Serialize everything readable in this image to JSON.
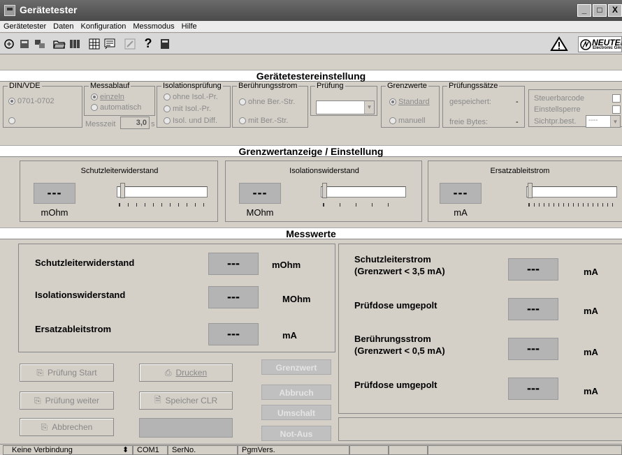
{
  "window": {
    "title": "Gerätetester",
    "minimize": "_",
    "maximize": "□",
    "close": "X"
  },
  "menu": [
    "Gerätetester",
    "Daten",
    "Konfiguration",
    "Messmodus",
    "Hilfe"
  ],
  "brand": {
    "logo_text": "NEUTEK",
    "logo_sub": "Electronic Gm"
  },
  "sections": {
    "einstellung": "Gerätetestereinstellung",
    "grenzwert": "Grenzwertanzeige / Einstellung",
    "messwerte": "Messwerte"
  },
  "settings": {
    "din": {
      "legend": "DIN/VDE",
      "opt1": "0701-0702",
      "opt2": ""
    },
    "messablauf": {
      "legend": "Messablauf",
      "opt1": "einzeln",
      "opt2": "automatisch",
      "messzeit_label": "Messzeit",
      "messzeit_value": "3,0",
      "messzeit_unit": "s"
    },
    "isolation": {
      "legend": "Isolationsprüfung",
      "opt1": "ohne Isol.-Pr.",
      "opt2": "mit Isol.-Pr.",
      "opt3": "Isol. und Diff."
    },
    "beruehrung": {
      "legend": "Berührungsstrom",
      "opt1": "ohne Ber.-Str.",
      "opt2": "mit Ber.-Str."
    },
    "pruefung": {
      "legend": "Prüfung",
      "value": ""
    },
    "grenzwerte": {
      "legend": "Grenzwerte",
      "opt1": "Standard",
      "opt2": "manuell"
    },
    "pruefsaetze": {
      "legend": "Prüfungssätze",
      "row1_label": "gespeichert:",
      "row1_value": "-",
      "row2_label": "freie Bytes:",
      "row2_value": "-"
    },
    "extra": {
      "barcode": "Steuerbarcode",
      "sperre": "Einstellsperre",
      "sichtpr": "Sichtpr.best.",
      "sichtpr_value": "----"
    }
  },
  "limits": [
    {
      "title": "Schutzleiterwiderstand",
      "display": "---",
      "unit": "mOhm"
    },
    {
      "title": "Isolationswiderstand",
      "display": "---",
      "unit": "MOhm"
    },
    {
      "title": "Ersatzableitstrom",
      "display": "---",
      "unit": "mA"
    }
  ],
  "measure_left": [
    {
      "label": "Schutzleiterwiderstand",
      "display": "---",
      "unit": "mOhm"
    },
    {
      "label": "Isolationswiderstand",
      "display": "---",
      "unit": "MOhm"
    },
    {
      "label": "Ersatzableitstrom",
      "display": "---",
      "unit": "mA"
    }
  ],
  "measure_right": [
    {
      "label1": "Schutzleiterstrom",
      "label2": "(Grenzwert < 3,5 mA)",
      "display": "---",
      "unit": "mA"
    },
    {
      "label1": "Prüfdose umgepolt",
      "label2": "",
      "display": "---",
      "unit": "mA"
    },
    {
      "label1": "Berührungsstrom",
      "label2": "(Grenzwert < 0,5 mA)",
      "display": "---",
      "unit": "mA"
    },
    {
      "label1": "Prüfdose umgepolt",
      "label2": "",
      "display": "---",
      "unit": "mA"
    }
  ],
  "buttons": {
    "start": "Prüfung Start",
    "drucken": "Drucken",
    "weiter": "Prüfung weiter",
    "speicher": "Speicher CLR",
    "abbrechen": "Abbrechen"
  },
  "indicators": [
    "Grenzwert",
    "Abbruch",
    "Umschalt",
    "Not-Aus"
  ],
  "status": {
    "connection": "Keine Verbindung",
    "port": "COM1",
    "serno": "SerNo.",
    "pgmvers": "PgmVers."
  }
}
